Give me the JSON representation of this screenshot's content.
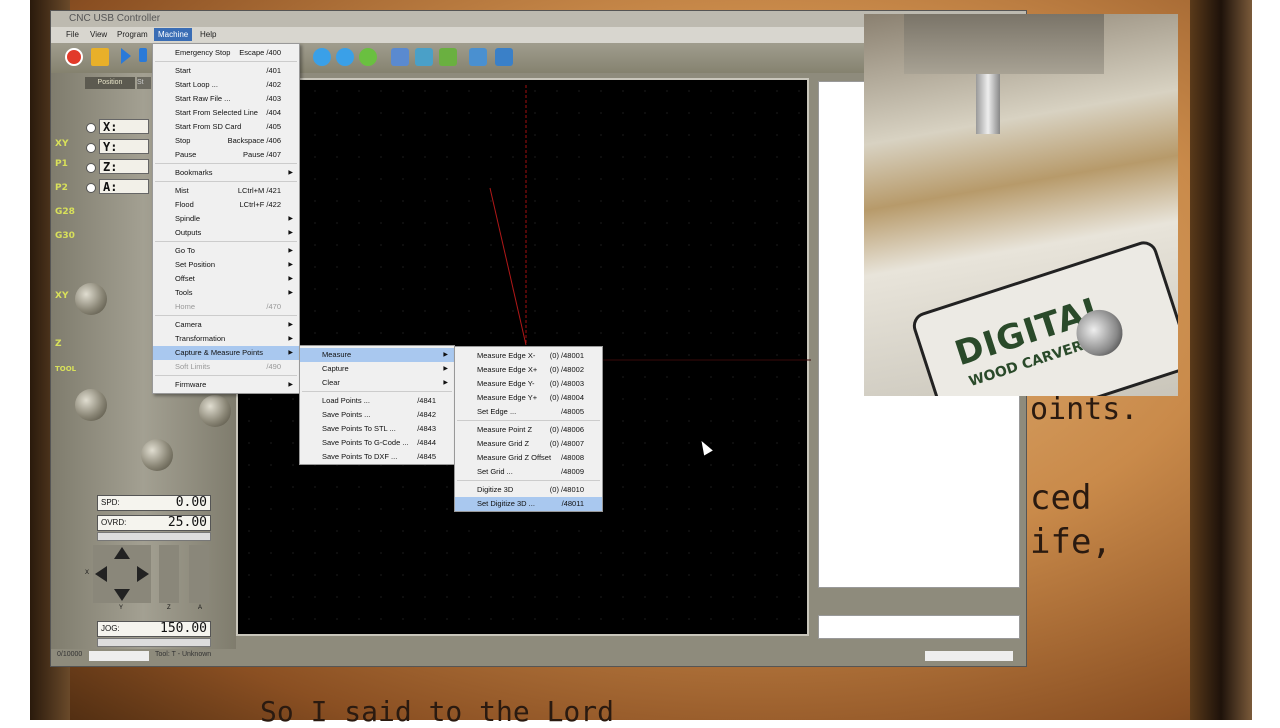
{
  "window": {
    "title": "CNC USB Controller"
  },
  "menubar": {
    "items": [
      {
        "label": "File"
      },
      {
        "label": "View"
      },
      {
        "label": "Program"
      },
      {
        "label": "Machine"
      },
      {
        "label": "Help"
      }
    ]
  },
  "left_panel": {
    "tabs": [
      "Position",
      "St"
    ],
    "axes": [
      {
        "label": "X:"
      },
      {
        "label": "Y:"
      },
      {
        "label": "Z:"
      },
      {
        "label": "A:"
      }
    ],
    "side_icons": [
      "XY",
      "P1",
      "P2",
      "G28",
      "G30",
      "XY",
      "Z",
      "TOOL"
    ],
    "spd": {
      "label": "SPD:",
      "value": "0.00"
    },
    "ovrd": {
      "label": "OVRD:",
      "value": "25.00"
    },
    "jog": {
      "label": "JOG:",
      "value": "150.00"
    },
    "jog_axes": [
      "X",
      "Y",
      "Z",
      "A"
    ]
  },
  "status": {
    "progress": "0/10000",
    "tool": "Tool: T - Unknown"
  },
  "machine_menu": [
    {
      "label": "Emergency Stop",
      "shortcut": "Escape /400"
    },
    {
      "sep": true
    },
    {
      "label": "Start",
      "shortcut": "/401"
    },
    {
      "label": "Start Loop ...",
      "shortcut": "/402"
    },
    {
      "label": "Start Raw File ...",
      "shortcut": "/403"
    },
    {
      "label": "Start From Selected Line",
      "shortcut": "/404"
    },
    {
      "label": "Start From SD Card",
      "shortcut": "/405"
    },
    {
      "label": "Stop",
      "shortcut": "Backspace /406"
    },
    {
      "label": "Pause",
      "shortcut": "Pause /407"
    },
    {
      "sep": true
    },
    {
      "label": "Bookmarks",
      "submenu": true
    },
    {
      "sep": true
    },
    {
      "label": "Mist",
      "shortcut": "LCtrl+M /421"
    },
    {
      "label": "Flood",
      "shortcut": "LCtrl+F /422"
    },
    {
      "label": "Spindle",
      "submenu": true
    },
    {
      "label": "Outputs",
      "submenu": true
    },
    {
      "sep": true
    },
    {
      "label": "Go To",
      "submenu": true
    },
    {
      "label": "Set Position",
      "submenu": true
    },
    {
      "label": "Offset",
      "submenu": true
    },
    {
      "label": "Tools",
      "submenu": true
    },
    {
      "label": "Home",
      "shortcut": "/470",
      "disabled": true
    },
    {
      "sep": true
    },
    {
      "label": "Camera",
      "submenu": true
    },
    {
      "label": "Transformation",
      "submenu": true
    },
    {
      "label": "Capture & Measure Points",
      "submenu": true,
      "highlight": true
    },
    {
      "label": "Soft Limits",
      "shortcut": "/490",
      "disabled": true
    },
    {
      "sep": true
    },
    {
      "label": "Firmware",
      "submenu": true
    }
  ],
  "capture_menu": [
    {
      "label": "Measure",
      "submenu": true,
      "highlight": true
    },
    {
      "label": "Capture",
      "submenu": true
    },
    {
      "label": "Clear",
      "submenu": true
    },
    {
      "sep": true
    },
    {
      "label": "Load Points ...",
      "shortcut": "/4841"
    },
    {
      "label": "Save Points ...",
      "shortcut": "/4842"
    },
    {
      "label": "Save Points To STL ...",
      "shortcut": "/4843"
    },
    {
      "label": "Save Points To G-Code ...",
      "shortcut": "/4844"
    },
    {
      "label": "Save Points To DXF ...",
      "shortcut": "/4845"
    }
  ],
  "measure_menu": [
    {
      "label": "Measure Edge X-",
      "shortcut": "(0) /48001"
    },
    {
      "label": "Measure Edge X+",
      "shortcut": "(0) /48002"
    },
    {
      "label": "Measure Edge Y-",
      "shortcut": "(0) /48003"
    },
    {
      "label": "Measure Edge Y+",
      "shortcut": "(0) /48004"
    },
    {
      "label": "Set Edge ...",
      "shortcut": "/48005"
    },
    {
      "sep": true
    },
    {
      "label": "Measure Point Z",
      "shortcut": "(0) /48006"
    },
    {
      "label": "Measure Grid Z",
      "shortcut": "(0) /48007"
    },
    {
      "label": "Measure Grid Z Offset",
      "shortcut": "/48008"
    },
    {
      "label": "Set Grid ...",
      "shortcut": "/48009"
    },
    {
      "sep": true
    },
    {
      "label": "Digitize 3D",
      "shortcut": "(0) /48010"
    },
    {
      "label": "Set Digitize 3D ...",
      "shortcut": "/48011",
      "highlight": true
    }
  ],
  "background": {
    "lines": [
      "oints.",
      "ced",
      "ife,",
      "So I said to the Lord"
    ]
  },
  "video": {
    "brand_line1": "DIGITAL",
    "brand_line2": "WOOD CARVER"
  }
}
